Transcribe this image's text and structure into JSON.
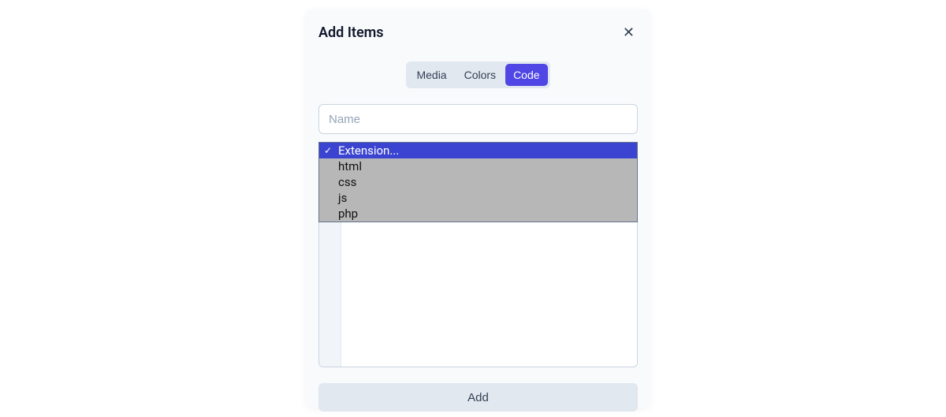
{
  "modal": {
    "title": "Add Items",
    "close_symbol": "✕",
    "tabs": {
      "media": "Media",
      "colors": "Colors",
      "code": "Code"
    },
    "name_placeholder": "Name",
    "extension_select": {
      "placeholder": "Extension...",
      "options": {
        "o0": "html",
        "o1": "css",
        "o2": "js",
        "o3": "php"
      }
    },
    "add_button": "Add"
  }
}
